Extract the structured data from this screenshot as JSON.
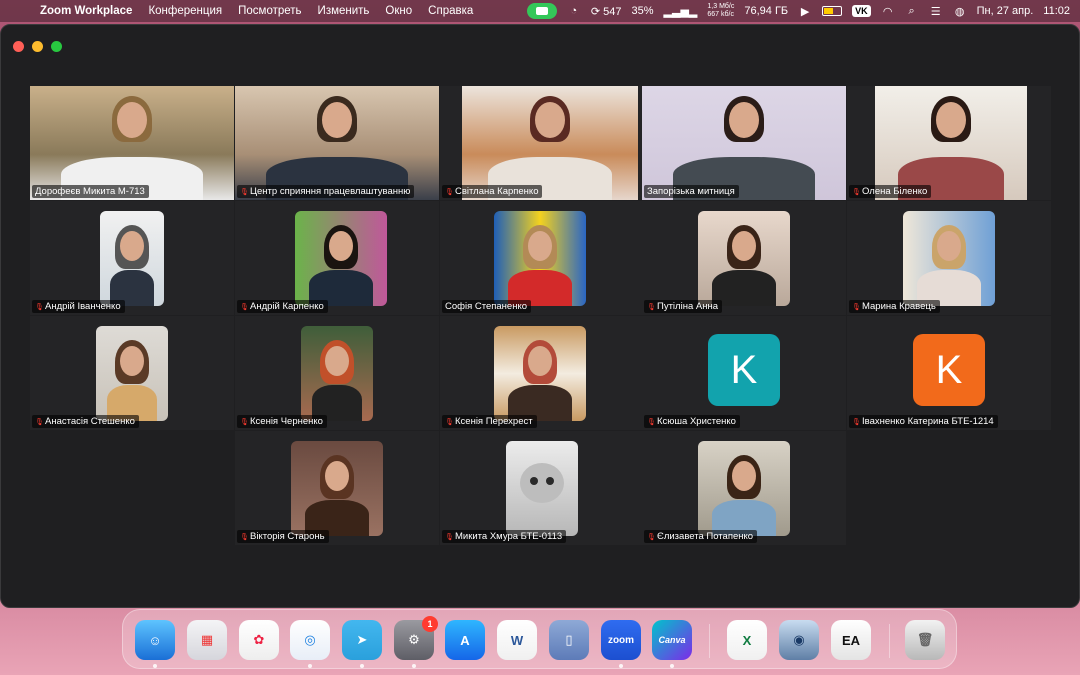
{
  "menubar": {
    "app_name": "Zoom Workplace",
    "items": [
      "Конференция",
      "Посмотреть",
      "Изменить",
      "Окно",
      "Справка"
    ],
    "cpu_count": "547",
    "cpu_percent": "35%",
    "net_up": "1,3 Мб/с",
    "net_down": "667 kб/с",
    "storage": "76,94 ГБ",
    "vk": "VK",
    "date": "Пн, 27 апр.",
    "time": "11:02"
  },
  "participants": [
    {
      "name": "Дорофеєв Микита М-713",
      "muted": false,
      "active": true,
      "type": "video"
    },
    {
      "name": "Центр сприяння працевлаштуванню",
      "muted": true,
      "type": "video"
    },
    {
      "name": "Світлана Карпенко",
      "muted": true,
      "type": "video"
    },
    {
      "name": "Запорізька митниця",
      "muted": false,
      "type": "video"
    },
    {
      "name": "Олена Біленко",
      "muted": true,
      "type": "video"
    },
    {
      "name": "Андрій Іванченко",
      "muted": true,
      "type": "photo"
    },
    {
      "name": "Андрій Карпенко",
      "muted": true,
      "type": "photo"
    },
    {
      "name": "Софія Степаненко",
      "muted": false,
      "type": "photo"
    },
    {
      "name": "Путіліна Анна",
      "muted": true,
      "type": "photo"
    },
    {
      "name": "Марина Кравець",
      "muted": true,
      "type": "photo"
    },
    {
      "name": "Анастасія Стешенко",
      "muted": true,
      "type": "photo"
    },
    {
      "name": "Ксенія Черненко",
      "muted": true,
      "type": "photo"
    },
    {
      "name": "Ксенія Перехрест",
      "muted": true,
      "type": "photo"
    },
    {
      "name": "Ксюша Христенко",
      "muted": true,
      "type": "letter",
      "letter": "K",
      "color": "#12a3ad"
    },
    {
      "name": "Івахненко Катерина БТЕ-1214",
      "muted": true,
      "type": "letter",
      "letter": "K",
      "color": "#f26a1b"
    },
    {
      "name": "Вікторія Старонь",
      "muted": true,
      "type": "photo"
    },
    {
      "name": "Микита Хмура БТЕ-0113",
      "muted": true,
      "type": "photo"
    },
    {
      "name": "Єлизавета Потапенко",
      "muted": true,
      "type": "photo"
    }
  ],
  "dock": {
    "items": [
      {
        "name": "Finder",
        "label": "☺"
      },
      {
        "name": "Launchpad",
        "label": "▦"
      },
      {
        "name": "Photos",
        "label": "✿"
      },
      {
        "name": "Safari",
        "label": "◎"
      },
      {
        "name": "Telegram",
        "label": "➤"
      },
      {
        "name": "System Settings",
        "label": "⚙",
        "badge": "1"
      },
      {
        "name": "App Store",
        "label": "A"
      },
      {
        "name": "Word",
        "label": "W"
      },
      {
        "name": "Simulator",
        "label": "▯"
      },
      {
        "name": "Zoom",
        "label": "zoom"
      },
      {
        "name": "Canva",
        "label": "Canva"
      },
      {
        "name": "Excel",
        "label": "X"
      },
      {
        "name": "Disk Utility",
        "label": "◉"
      },
      {
        "name": "EA",
        "label": "EA"
      },
      {
        "name": "Trash",
        "label": "🗑"
      }
    ]
  },
  "colors": {
    "active_speaker": "#3fcf3f",
    "muted": "#ff3b30",
    "window_bg": "#1f1f21"
  }
}
